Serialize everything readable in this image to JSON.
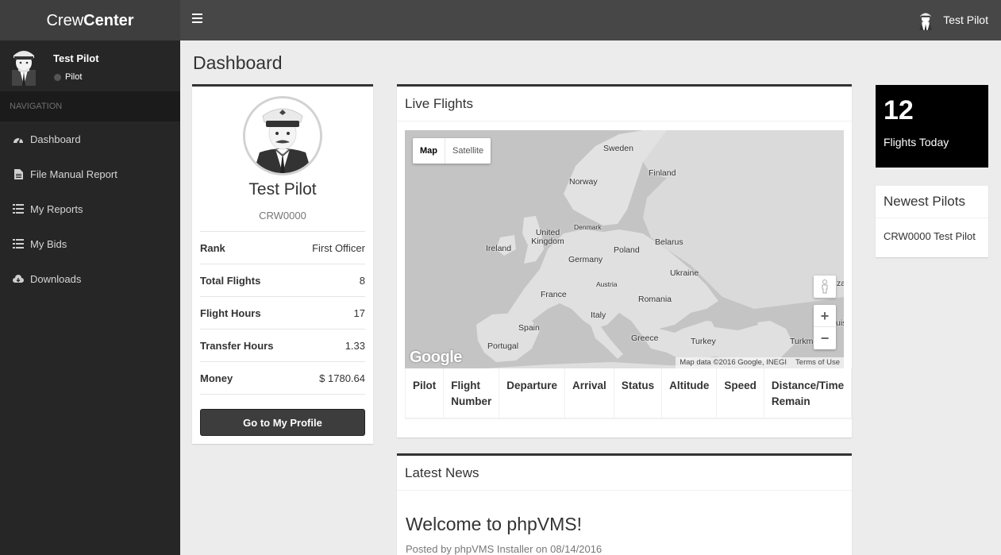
{
  "app": {
    "logo_light": "Crew",
    "logo_bold": "Center"
  },
  "header": {
    "user_name": "Test Pilot"
  },
  "sidebar": {
    "user_name": "Test Pilot",
    "user_role": "Pilot",
    "nav_header": "NAVIGATION",
    "items": [
      {
        "label": "Dashboard",
        "icon": "dashboard-icon"
      },
      {
        "label": "File Manual Report",
        "icon": "file-icon"
      },
      {
        "label": "My Reports",
        "icon": "list-icon"
      },
      {
        "label": "My Bids",
        "icon": "list-icon"
      },
      {
        "label": "Downloads",
        "icon": "cloud-download-icon"
      }
    ]
  },
  "page": {
    "title": "Dashboard"
  },
  "profile": {
    "name": "Test Pilot",
    "code": "CRW0000",
    "stats": [
      {
        "key": "Rank",
        "value": "First Officer"
      },
      {
        "key": "Total Flights",
        "value": "8"
      },
      {
        "key": "Flight Hours",
        "value": "17"
      },
      {
        "key": "Transfer Hours",
        "value": "1.33"
      },
      {
        "key": "Money",
        "value": "$ 1780.64"
      }
    ],
    "button": "Go to My Profile"
  },
  "live_flights": {
    "title": "Live Flights",
    "map": {
      "type_map": "Map",
      "type_satellite": "Satellite",
      "attribution": "Map data ©2016 Google, INEGI",
      "terms": "Terms of Use",
      "logo": "Google",
      "zoom_in": "+",
      "zoom_out": "−",
      "labels": [
        "Sweden",
        "Finland",
        "Norway",
        "Denmark",
        "United Kingdom",
        "Ireland",
        "Belarus",
        "Poland",
        "Germany",
        "Ukraine",
        "Austria",
        "France",
        "Romania",
        "Italy",
        "Spain",
        "Portugal",
        "Turkey",
        "Greece",
        "Turkme",
        "za",
        "uis"
      ]
    },
    "columns": [
      "Pilot",
      "Flight Number",
      "Departure",
      "Arrival",
      "Status",
      "Altitude",
      "Speed",
      "Distance/Time Remain"
    ]
  },
  "news": {
    "title": "Latest News",
    "headline": "Welcome to phpVMS!",
    "meta": "Posted by phpVMS Installer on 08/14/2016"
  },
  "flights_today": {
    "count": "12",
    "label": "Flights Today"
  },
  "newest_pilots": {
    "title": "Newest Pilots",
    "items": [
      "CRW0000 Test Pilot"
    ]
  }
}
